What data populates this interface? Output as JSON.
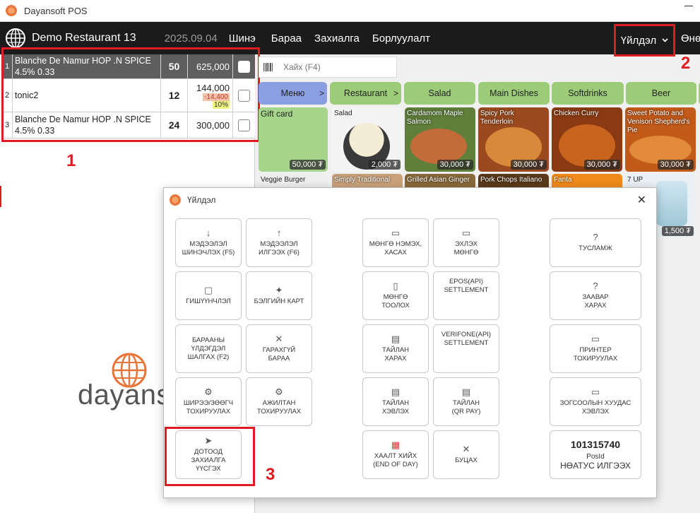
{
  "window": {
    "title": "Dayansoft POS"
  },
  "topnav": {
    "restaurant": "Demo Restaurant 13",
    "date": "2025.09.04",
    "items": [
      "Шинэ",
      "Бараа",
      "Захиалга",
      "Борлуулалт"
    ],
    "actions_label": "Үйлдэл",
    "next_label": "Өнө"
  },
  "order": {
    "rows": [
      {
        "idx": "1",
        "name": "Blanche De Namur HOP .N SPICE 4.5% 0.33",
        "qty": "50",
        "price": "625,000",
        "discount": "",
        "percent": "",
        "selected": true
      },
      {
        "idx": "2",
        "name": "tonic2",
        "qty": "12",
        "price": "144,000",
        "discount": "-14,400",
        "percent": "10%",
        "selected": false
      },
      {
        "idx": "3",
        "name": "Blanche De Namur HOP .N SPICE 4.5% 0.33",
        "qty": "24",
        "price": "300,000",
        "discount": "",
        "percent": "",
        "selected": false
      }
    ]
  },
  "annotations": {
    "one": "1",
    "two": "2",
    "three": "3"
  },
  "brand": {
    "text": "dayanso"
  },
  "search": {
    "placeholder": "Хайх (F4)"
  },
  "categories": [
    {
      "label": "Меню",
      "arrow": ">"
    },
    {
      "label": "Restaurant",
      "arrow": ">"
    },
    {
      "label": "Salad",
      "arrow": ""
    },
    {
      "label": "Main Dishes",
      "arrow": ""
    },
    {
      "label": "Softdrinks",
      "arrow": ""
    },
    {
      "label": "Beer",
      "arrow": ""
    }
  ],
  "tiles": [
    {
      "name": "Gift card",
      "price": "50,000 ₮"
    },
    {
      "name": "Salad",
      "price": "2,000 ₮"
    },
    {
      "name": "Cardamom Maple Salmon",
      "price": "30,000 ₮"
    },
    {
      "name": "Spicy Pork Tenderloin",
      "price": "30,000 ₮"
    },
    {
      "name": "Chicken Curry",
      "price": "30,000 ₮"
    },
    {
      "name": "Sweet Potato and Venison Shepherd's Pie",
      "price": "30,000 ₮"
    }
  ],
  "tiles2": [
    {
      "name": "Veggie Burger"
    },
    {
      "name": "Simply Traditional"
    },
    {
      "name": "Grilled Asian Ginger"
    },
    {
      "name": "Pork Chops Italiano"
    },
    {
      "name": "Fanta"
    },
    {
      "name": "7 UP",
      "price": "1,500 ₮"
    }
  ],
  "modal": {
    "title": "Үйлдэл",
    "close": "✕",
    "buttons": {
      "info_refresh": [
        "МЭДЭЭЛЭЛ",
        "ШИНЭЧЛЭХ (F5)"
      ],
      "info_send": [
        "МЭДЭЭЛЭЛ",
        "ИЛГЭЭХ (F6)"
      ],
      "membership": [
        "ГИШҮҮНЧЛЭЛ"
      ],
      "gift_card": [
        "БЭЛГИЙН КАРТ"
      ],
      "check_stock": [
        "БАРААНЫ",
        "ҮЛДЭГДЭЛ",
        "ШАЛГАХ (F2)"
      ],
      "missing_item": [
        "ГАРАХГҮЙ",
        "БАРАА"
      ],
      "table_settings": [
        "ШИРЭЭ/ЗӨӨГЧ",
        "ТОХИРУУЛАХ"
      ],
      "staff_settings": [
        "АЖИЛТАН",
        "ТОХИРУУЛАХ"
      ],
      "internal_order": [
        "ДОТООД",
        "ЗАХИАЛГА",
        "ҮҮСГЭХ"
      ],
      "cash_in_out": [
        "МӨНГӨ НЭМЭХ,",
        "ХАСАХ"
      ],
      "cash_balance": [
        "ЭХЛЭХ",
        "МӨНГӨ"
      ],
      "count_money": [
        "МӨНГӨ",
        "ТООЛОХ"
      ],
      "epos_settlement": [
        "EPOS(API)",
        "SETTLEMENT"
      ],
      "view_report": [
        "ТАЙЛАН",
        "ХАРАХ"
      ],
      "verifone_settlement": [
        "VERIFONE(API)",
        "SETTLEMENT"
      ],
      "print_report": [
        "ТАЙЛАН",
        "ХЭВЛЭХ"
      ],
      "qr_report": [
        "ТАЙЛАН",
        "(QR PAY)"
      ],
      "end_of_day": [
        "ХААЛТ ХИЙХ",
        "(END OF DAY)"
      ],
      "cancel": [
        "БУЦАХ"
      ],
      "help": [
        "ТУСЛАМЖ"
      ],
      "guide": [
        "ЗААВАР",
        "ХАРАХ"
      ],
      "printer_settings": [
        "ПРИНТЕР",
        "ТОХИРУУЛАХ"
      ],
      "print_blank": [
        "ЗОГСООЛЫН ХУУДАС",
        "ХЭВЛЭХ"
      ]
    },
    "pos": {
      "id": "101315740",
      "id_label": "PosId",
      "status_label": "НӨАТУС ИЛГЭЭХ"
    },
    "icons": {
      "info_refresh": "↓",
      "info_send": "↑",
      "membership": "▢",
      "gift_card": "✦",
      "missing_item": "✕",
      "table_settings": "⚙",
      "staff_settings": "⚙",
      "internal_order": "➤",
      "cash_in_out": "▭",
      "cash_balance": "▭",
      "count_money": "▯",
      "view_report": "▤",
      "print_report": "▤",
      "qr_report": "▤",
      "end_of_day": "▦",
      "cancel": "✕",
      "help": "?",
      "guide": "?",
      "printer_settings": "▭",
      "print_blank": "▭"
    }
  },
  "colors": {
    "accent_red": "#e11b22",
    "category_green": "#9ccc78",
    "category_active": "#8a9fe0",
    "topbar": "#1b1b1b",
    "brand_orange": "#e8753a"
  }
}
